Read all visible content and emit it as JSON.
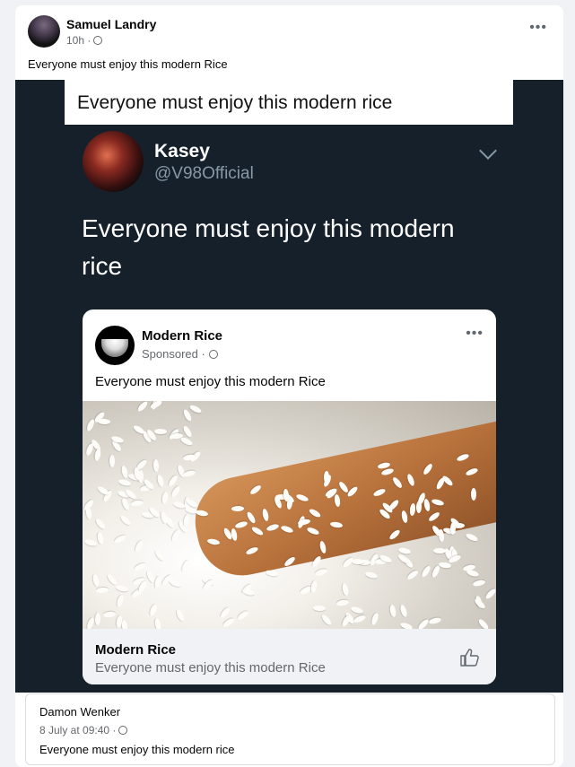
{
  "post": {
    "author": "Samuel Landry",
    "time": "10h ·",
    "caption": "Everyone must enjoy this modern Rice",
    "more_label": "•••"
  },
  "screenshot": {
    "banner_text": "Everyone must enjoy this modern rice",
    "tweet": {
      "name": "Kasey",
      "handle": "@V98Official",
      "text": "Everyone must enjoy this modern rice"
    },
    "fb_card": {
      "page_name": "Modern Rice",
      "sponsored": "Sponsored ·",
      "caption": "Everyone must enjoy this modern Rice",
      "more_label": "•••",
      "footer_title": "Modern Rice",
      "footer_subtitle": "Everyone must enjoy this modern Rice"
    }
  },
  "shared_reply": {
    "author": "Damon Wenker",
    "time": "8 July at 09:40 ·",
    "text": "Everyone must enjoy this modern rice"
  },
  "colors": {
    "twitter_bg": "#15202b",
    "twitter_secondary": "#8899a6",
    "fb_secondary": "#65676b"
  },
  "icons": [
    "globe-icon",
    "more-icon",
    "chevron-down-icon",
    "thumbs-up-icon"
  ]
}
